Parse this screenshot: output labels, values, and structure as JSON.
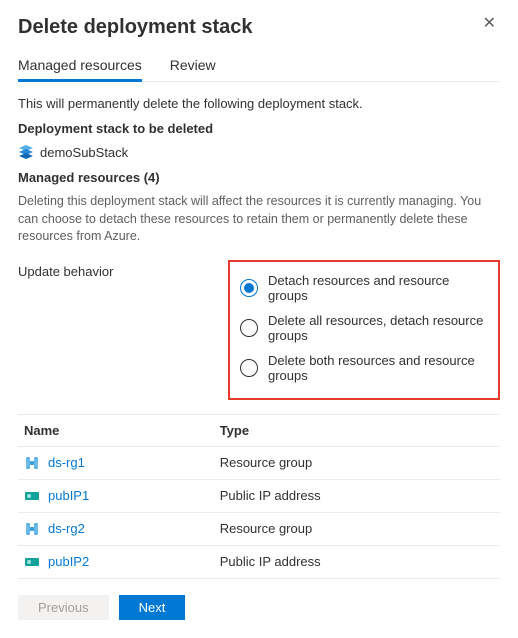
{
  "header": {
    "title": "Delete deployment stack"
  },
  "tabs": [
    {
      "label": "Managed resources",
      "active": true
    },
    {
      "label": "Review",
      "active": false
    }
  ],
  "intro": "This will permanently delete the following deployment stack.",
  "stack_section": {
    "heading": "Deployment stack to be deleted",
    "stack_name": "demoSubStack"
  },
  "managed_heading": "Managed resources (4)",
  "managed_desc": "Deleting this deployment stack will affect the resources it is currently managing. You can choose to detach these resources to retain them or permanently delete these resources from Azure.",
  "update_behavior": {
    "label": "Update behavior",
    "options": [
      {
        "label": "Detach resources and resource groups",
        "selected": true
      },
      {
        "label": "Delete all resources, detach resource groups",
        "selected": false
      },
      {
        "label": "Delete both resources and resource groups",
        "selected": false
      }
    ]
  },
  "table": {
    "columns": {
      "name": "Name",
      "type": "Type"
    },
    "rows": [
      {
        "name": "ds-rg1",
        "type": "Resource group",
        "icon": "resource-group"
      },
      {
        "name": "pubIP1",
        "type": "Public IP address",
        "icon": "public-ip"
      },
      {
        "name": "ds-rg2",
        "type": "Resource group",
        "icon": "resource-group"
      },
      {
        "name": "pubIP2",
        "type": "Public IP address",
        "icon": "public-ip"
      }
    ]
  },
  "footer": {
    "previous": "Previous",
    "next": "Next"
  }
}
